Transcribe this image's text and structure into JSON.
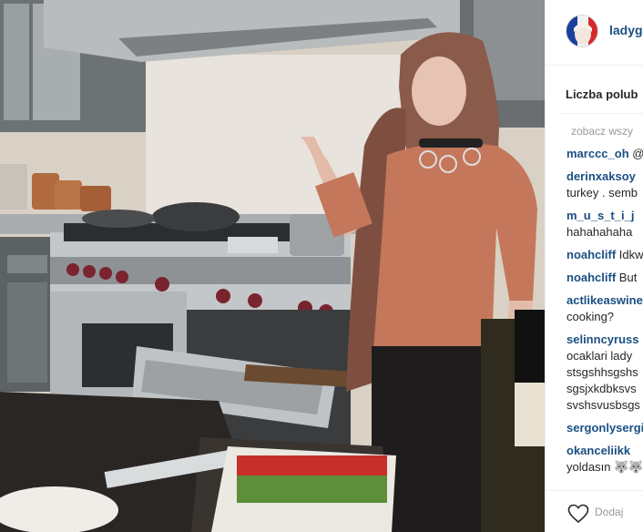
{
  "post": {
    "username": "ladyg",
    "likes_label": "Liczba polub",
    "view_all_label": "zobacz wszy",
    "add_comment_placeholder": "Dodaj",
    "photo_subject": "person-in-kitchen-photo"
  },
  "comments": [
    {
      "user": "marccc_oh",
      "text": "@",
      "inline": true
    },
    {
      "user": "derinxaksoy",
      "lines": [
        "turkey . semb"
      ]
    },
    {
      "user": "m_u_s_t_i_j",
      "lines": [
        "hahahahaha"
      ]
    },
    {
      "user": "noahcliff",
      "text": "Idkw",
      "inline": true
    },
    {
      "user": "noahcliff",
      "text": "But",
      "inline": true
    },
    {
      "user": "actlikeaswine",
      "lines": [
        "cooking?"
      ]
    },
    {
      "user": "selinncyruss",
      "lines": [
        "ocaklari lady",
        "stsgshhsgshs",
        "sgsjxkdbksvs",
        "svshsvusbsgs"
      ]
    },
    {
      "user": "sergonlysergi",
      "lines": []
    },
    {
      "user": "okanceliikk",
      "lines": [
        "yoldasın 🐺🐺"
      ]
    }
  ],
  "colors": {
    "username": "#1b4f84",
    "muted": "#999999",
    "text": "#262626",
    "divider": "#efefef"
  },
  "icons": {
    "heart": "heart-icon",
    "avatar": "avatar"
  }
}
